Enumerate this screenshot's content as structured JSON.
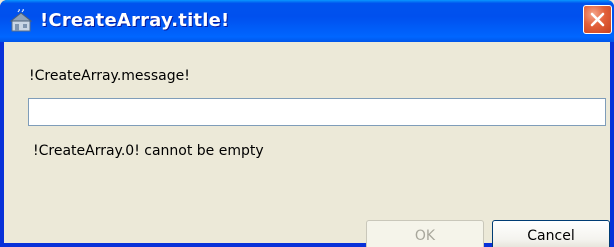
{
  "window": {
    "title": "!CreateArray.title!",
    "icon": "java-app-icon",
    "close_icon": "close-icon"
  },
  "dialog": {
    "message": "!CreateArray.message!",
    "input": {
      "value": "",
      "placeholder": ""
    },
    "error": "!CreateArray.0! cannot be empty"
  },
  "buttons": {
    "ok_label": "OK",
    "ok_enabled": false,
    "cancel_label": "Cancel"
  },
  "colors": {
    "titlebar": "#0055ea",
    "close": "#e2603a",
    "client": "#ece9d8",
    "disabled_text": "#a8a79c"
  }
}
